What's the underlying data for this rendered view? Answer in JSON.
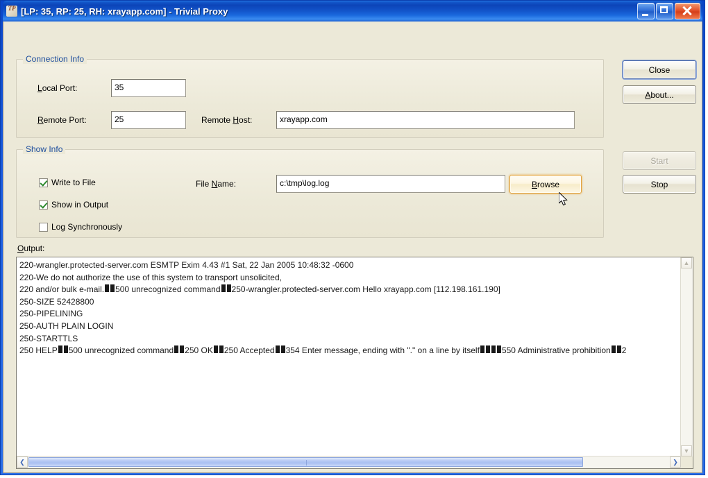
{
  "window": {
    "title": "[LP: 35, RP: 25, RH: xrayapp.com] - Trivial Proxy",
    "icon": "app-icon",
    "minimize_label": "minimize-icon",
    "maximize_label": "maximize-icon",
    "close_label": "close-icon",
    "titlebar_color": "#0c44b8",
    "client_color": "#ece9d8"
  },
  "connection_group": {
    "caption": "Connection Info",
    "local_port": {
      "label_pre": "",
      "label_accel": "L",
      "label_post": "ocal Port:",
      "value": "35"
    },
    "remote_port": {
      "label_pre": "",
      "label_accel": "R",
      "label_post": "emote Port:",
      "value": "25"
    },
    "remote_host": {
      "label_pre": "Remote ",
      "label_accel": "H",
      "label_post": "ost:",
      "value": "xrayapp.com"
    }
  },
  "show_group": {
    "caption": "Show Info",
    "checkboxes": [
      {
        "label": "Write to File",
        "checked": true
      },
      {
        "label": "Show in Output",
        "checked": true
      },
      {
        "label": "Log Synchronously",
        "checked": false
      }
    ],
    "file_name": {
      "label_pre": "File ",
      "label_accel": "N",
      "label_post": "ame:",
      "value": "c:\\tmp\\log.log"
    },
    "browse_button": {
      "label_pre": "",
      "label_accel": "B",
      "label_post": "rowse",
      "state": "hover"
    }
  },
  "buttons": {
    "close": {
      "label": "Close",
      "state": "default"
    },
    "about": {
      "label_pre": "",
      "label_accel": "A",
      "label_post": "bout...",
      "state": "normal"
    },
    "start": {
      "label": "Start",
      "state": "disabled"
    },
    "stop": {
      "label": "Stop",
      "state": "normal"
    }
  },
  "output": {
    "label_accel": "O",
    "label_post": "utput:",
    "lines": [
      "220-wrangler.protected-server.com ESMTP Exim 4.43 #1 Sat, 22 Jan 2005 10:48:32 -0600",
      "220-We do not authorize the use of this system to transport unsolicited,",
      "220 and/or bulk e-mail.¶¶500 unrecognized command¶¶250-wrangler.protected-server.com Hello xrayapp.com [112.198.161.190]",
      "250-SIZE 52428800",
      "250-PIPELINING",
      "250-AUTH PLAIN LOGIN",
      "250-STARTTLS",
      "250 HELP¶¶500 unrecognized command¶¶250 OK¶¶250 Accepted¶¶354 Enter message, ending with \".\" on a line by itself¶¶¶¶550 Administrative prohibition¶¶2"
    ],
    "vscroll": {
      "up_arrow": "▲",
      "down_arrow": "▼"
    },
    "hscroll": {
      "left_arrow": "❮",
      "right_arrow": "❯",
      "thumb_percent": 85
    }
  }
}
